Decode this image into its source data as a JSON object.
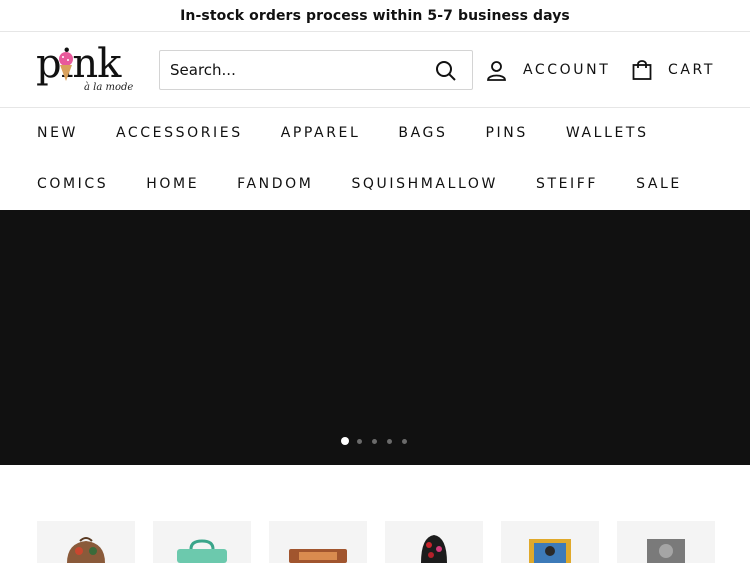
{
  "announcement": "In-stock orders process within 5-7 business days",
  "logo": {
    "word": "pink",
    "tagline": "à la mode"
  },
  "search": {
    "placeholder": "Search..."
  },
  "header_links": {
    "account": "ACCOUNT",
    "cart": "CART"
  },
  "nav": {
    "row1": [
      "NEW",
      "ACCESSORIES",
      "APPAREL",
      "BAGS",
      "PINS",
      "WALLETS"
    ],
    "row2": [
      "COMICS",
      "HOME",
      "FANDOM",
      "SQUISHMALLOW",
      "STEIFF",
      "SALE"
    ]
  },
  "hero": {
    "slide_count": 5,
    "active_slide": 1
  },
  "colors": {
    "hero_bg": "#111111",
    "logo_pink": "#e85a9b"
  }
}
